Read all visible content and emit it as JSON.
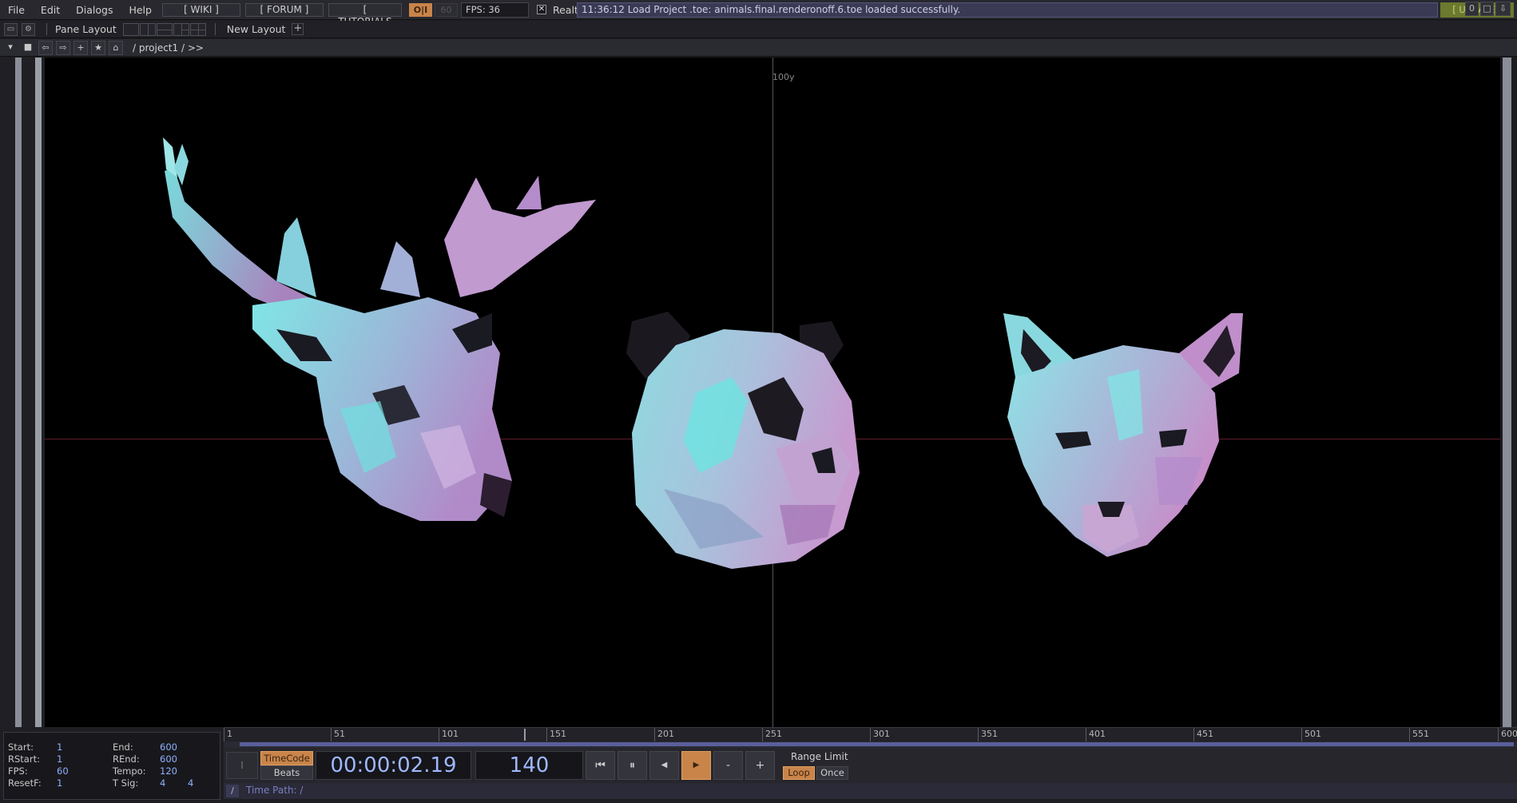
{
  "menu": {
    "file": "File",
    "edit": "Edit",
    "dialogs": "Dialogs",
    "help": "Help",
    "wiki": "[ WIKI ]",
    "forum": "[ FORUM ]",
    "tutorials": "[ TUTORIALS ]",
    "oi": "O|I",
    "sixty": "60",
    "fps": "FPS:  36",
    "realtime": "Realtime",
    "status": "11:36:12 Load Project .toe: animals.final.renderonoff.6.toe loaded successfully.",
    "update": "[ UPDATE ]"
  },
  "panebar": {
    "pane_layout": "Pane Layout",
    "new_layout": "New Layout",
    "plus": "+"
  },
  "pathbar": {
    "path": "/ project1 / >>",
    "counter": "0"
  },
  "viewport": {
    "axis_label": "100y",
    "objects": [
      "deer-head",
      "panda-head",
      "fox-head"
    ]
  },
  "timeline": {
    "ticks": [
      "1",
      "51",
      "101",
      "151",
      "201",
      "251",
      "301",
      "351",
      "401",
      "451",
      "501",
      "551",
      "600"
    ]
  },
  "info": {
    "start_label": "Start:",
    "start": "1",
    "end_label": "End:",
    "end": "600",
    "rstart_label": "RStart:",
    "rstart": "1",
    "rend_label": "REnd:",
    "rend": "600",
    "fps_label": "FPS:",
    "fps": "60",
    "tempo_label": "Tempo:",
    "tempo": "120",
    "resetf_label": "ResetF:",
    "resetf": "1",
    "tsig_label": "T Sig:",
    "tsig_a": "4",
    "tsig_b": "4"
  },
  "transport": {
    "timecode": "TimeCode",
    "beats": "Beats",
    "time": "00:00:02.19",
    "frame": "140",
    "range_limit": "Range Limit",
    "loop": "Loop",
    "once": "Once",
    "minus": "-",
    "plus": "+"
  },
  "timepath": {
    "slash": "/",
    "text": "Time Path: /"
  },
  "colors": {
    "accent_orange": "#c9844a",
    "time_blue": "#9fb8ff",
    "status_bg": "#3a3a55",
    "update_green": "#6b7a2e"
  }
}
